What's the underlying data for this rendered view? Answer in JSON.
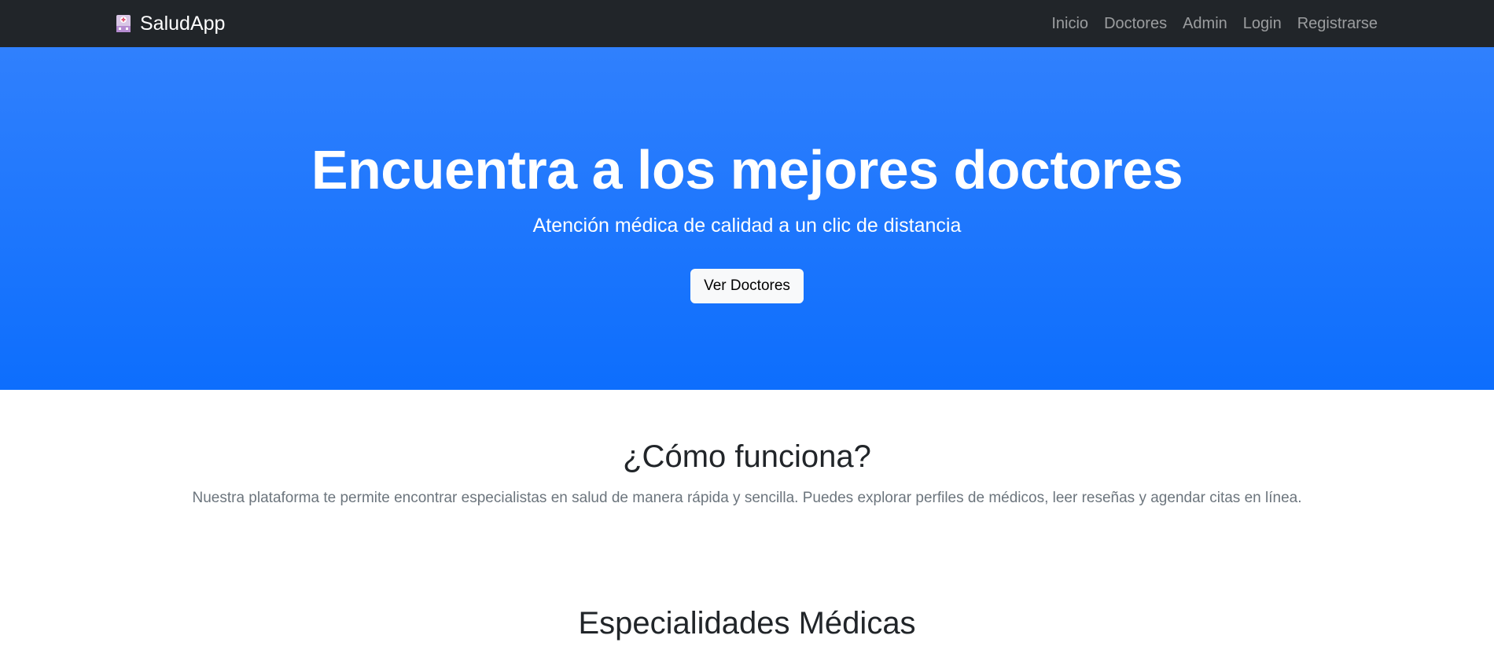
{
  "navbar": {
    "brand": {
      "icon": "hospital-icon",
      "label": "SaludApp"
    },
    "links": [
      {
        "label": "Inicio"
      },
      {
        "label": "Doctores"
      },
      {
        "label": "Admin"
      },
      {
        "label": "Login"
      },
      {
        "label": "Registrarse"
      }
    ]
  },
  "hero": {
    "title": "Encuentra a los mejores doctores",
    "subtitle": "Atención médica de calidad a un clic de distancia",
    "button_label": "Ver Doctores"
  },
  "how_it_works": {
    "title": "¿Cómo funciona?",
    "text": "Nuestra plataforma te permite encontrar especialistas en salud de manera rápida y sencilla. Puedes explorar perfiles de médicos, leer reseñas y agendar citas en línea."
  },
  "specialties": {
    "title": "Especialidades Médicas"
  },
  "colors": {
    "navbar_bg": "#212529",
    "hero_top": "#3080fd",
    "hero_bottom": "#0d6efd",
    "muted_text": "#6c757d"
  }
}
